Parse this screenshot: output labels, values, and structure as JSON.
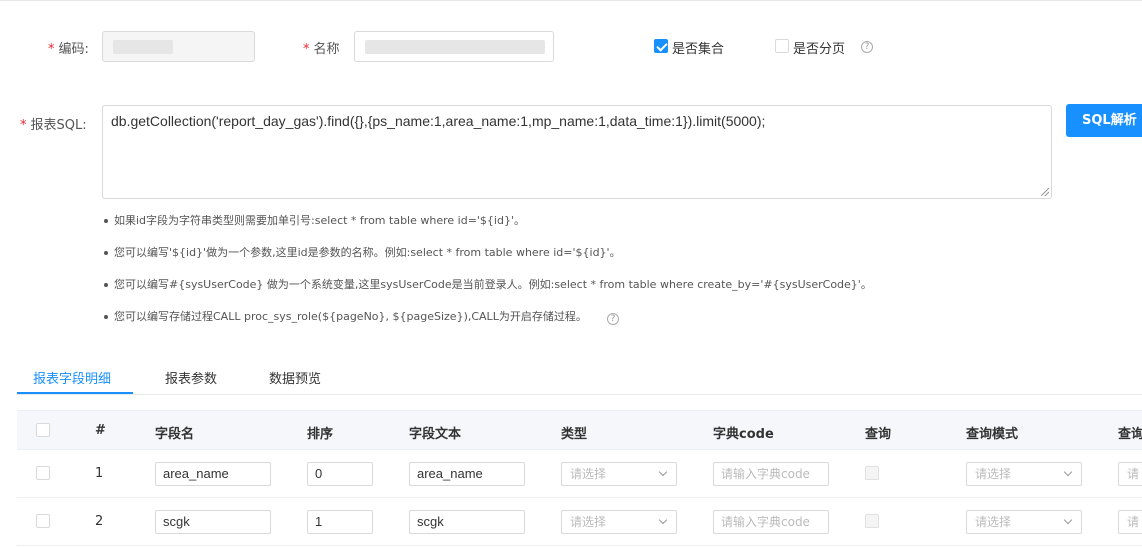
{
  "form": {
    "code_label": "编码:",
    "name_label": "名称",
    "is_collection_label": "是否集合",
    "is_collection_checked": true,
    "is_paging_label": "是否分页",
    "is_paging_checked": false,
    "sql_label": "报表SQL:",
    "sql_value": "db.getCollection('report_day_gas').find({},{ps_name:1,area_name:1,mp_name:1,data_time:1}).limit(5000);",
    "sql_parse_button": "SQL解析",
    "required_mark": "*"
  },
  "tips": [
    "如果id字段为字符串类型则需要加单引号:select * from table where id='${id}'。",
    "您可以编写'${id}'做为一个参数,这里id是参数的名称。例如:select * from table where id='${id}'。",
    "您可以编写#{sysUserCode} 做为一个系统变量,这里sysUserCode是当前登录人。例如:select * from table where create_by='#{sysUserCode}'。",
    "您可以编写存储过程CALL proc_sys_role(${pageNo}, ${pageSize}),CALL为开启存储过程。"
  ],
  "tabs": [
    {
      "label": "报表字段明细",
      "active": true
    },
    {
      "label": "报表参数",
      "active": false
    },
    {
      "label": "数据预览",
      "active": false
    }
  ],
  "table": {
    "headers": [
      "#",
      "字段名",
      "排序",
      "字段文本",
      "类型",
      "字典code",
      "查询",
      "查询模式",
      "查询"
    ],
    "rows": [
      {
        "index": "1",
        "field_name": "area_name",
        "order": "0",
        "field_text": "area_name",
        "type_placeholder": "请选择",
        "dict_placeholder": "请输入字典code",
        "query_mode_placeholder": "请选择",
        "last_placeholder": "请"
      },
      {
        "index": "2",
        "field_name": "scgk",
        "order": "1",
        "field_text": "scgk",
        "type_placeholder": "请选择",
        "dict_placeholder": "请输入字典code",
        "query_mode_placeholder": "请选择",
        "last_placeholder": "请"
      }
    ]
  },
  "colors": {
    "accent": "#1890ff",
    "required": "#f5222d"
  }
}
